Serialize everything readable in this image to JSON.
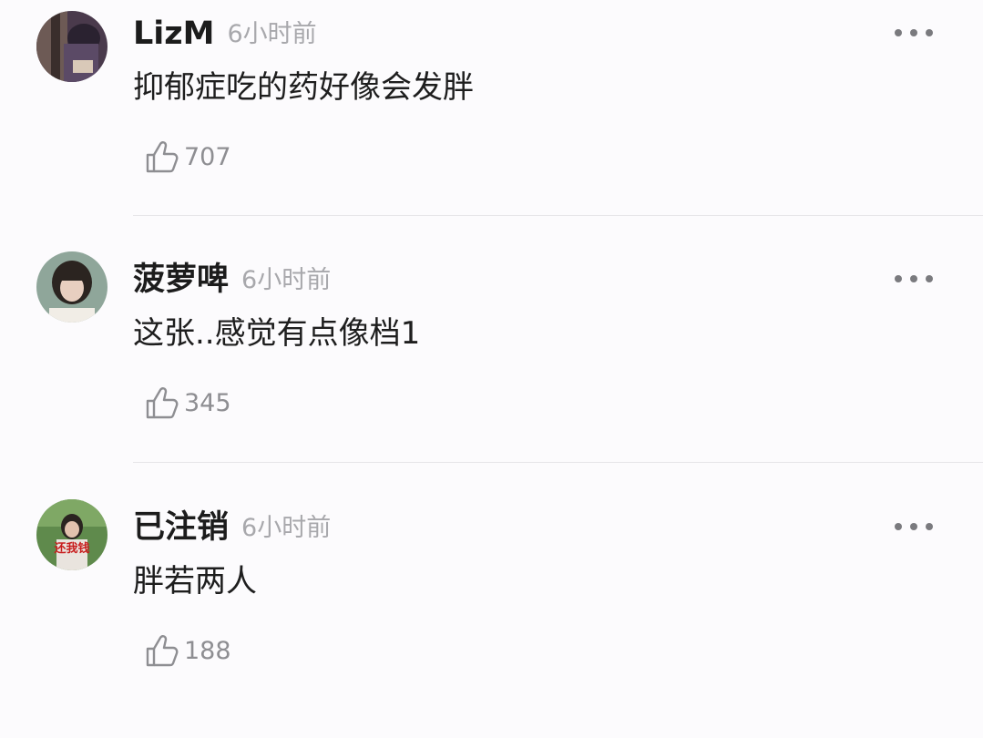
{
  "comments": [
    {
      "username": "LizM",
      "time": "6小时前",
      "text": "抑郁症吃的药好像会发胖",
      "likes": "707",
      "avatar_icon": "avatar-photo-tree-person",
      "more_icon": "more-dots-icon",
      "like_icon": "thumbs-up-icon"
    },
    {
      "username": "菠萝啤",
      "time": "6小时前",
      "text": "这张..感觉有点像档1",
      "likes": "345",
      "avatar_icon": "avatar-photo-girl",
      "more_icon": "more-dots-icon",
      "like_icon": "thumbs-up-icon"
    },
    {
      "username": "已注销",
      "time": "6小时前",
      "text": "胖若两人",
      "likes": "188",
      "avatar_icon": "avatar-photo-meme",
      "avatar_caption": "还我钱",
      "more_icon": "more-dots-icon",
      "like_icon": "thumbs-up-icon"
    }
  ],
  "colors": {
    "background": "#fcfbfd",
    "username": "#1c1c1c",
    "time": "#a8a8ac",
    "text": "#1e1e1e",
    "like": "#8e8e92",
    "divider": "#e6e5e8"
  }
}
